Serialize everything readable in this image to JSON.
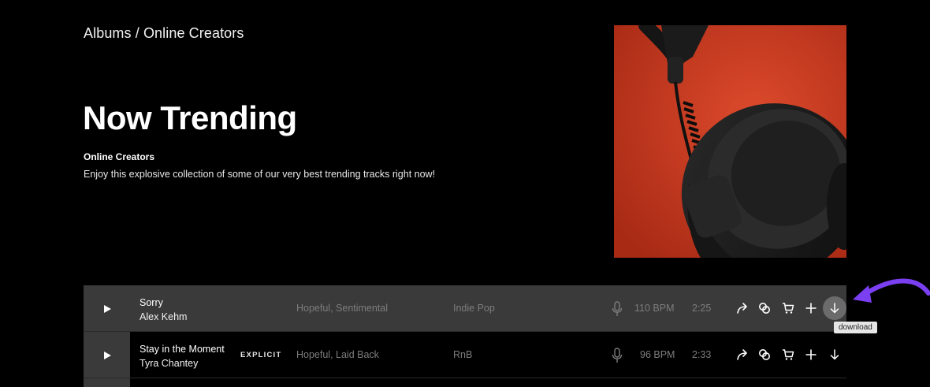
{
  "breadcrumb": {
    "parent": "Albums",
    "separator": " / ",
    "current": "Online Creators"
  },
  "header": {
    "title": "Now Trending",
    "subtitle": "Online Creators",
    "description": "Enjoy this explosive collection of some of our very best trending tracks right now!"
  },
  "colors": {
    "cover_bg": "#c8391f",
    "active_row": "#3a3a3a",
    "annotation": "#7b3ff2"
  },
  "tracks": [
    {
      "title": "Sorry",
      "artist": "Alex Kehm",
      "explicit": "",
      "mood": "Hopeful, Sentimental",
      "genre": "Indie Pop",
      "bpm": "110 BPM",
      "duration": "2:25"
    },
    {
      "title": "Stay in the Moment",
      "artist": "Tyra Chantey",
      "explicit": "EXPLICIT",
      "mood": "Hopeful, Laid Back",
      "genre": "RnB",
      "bpm": "96 BPM",
      "duration": "2:33"
    }
  ],
  "icons": [
    "play-icon",
    "microphone-icon",
    "share-icon",
    "link-icon",
    "cart-icon",
    "plus-icon",
    "download-icon"
  ],
  "tooltip": {
    "text": "download"
  }
}
